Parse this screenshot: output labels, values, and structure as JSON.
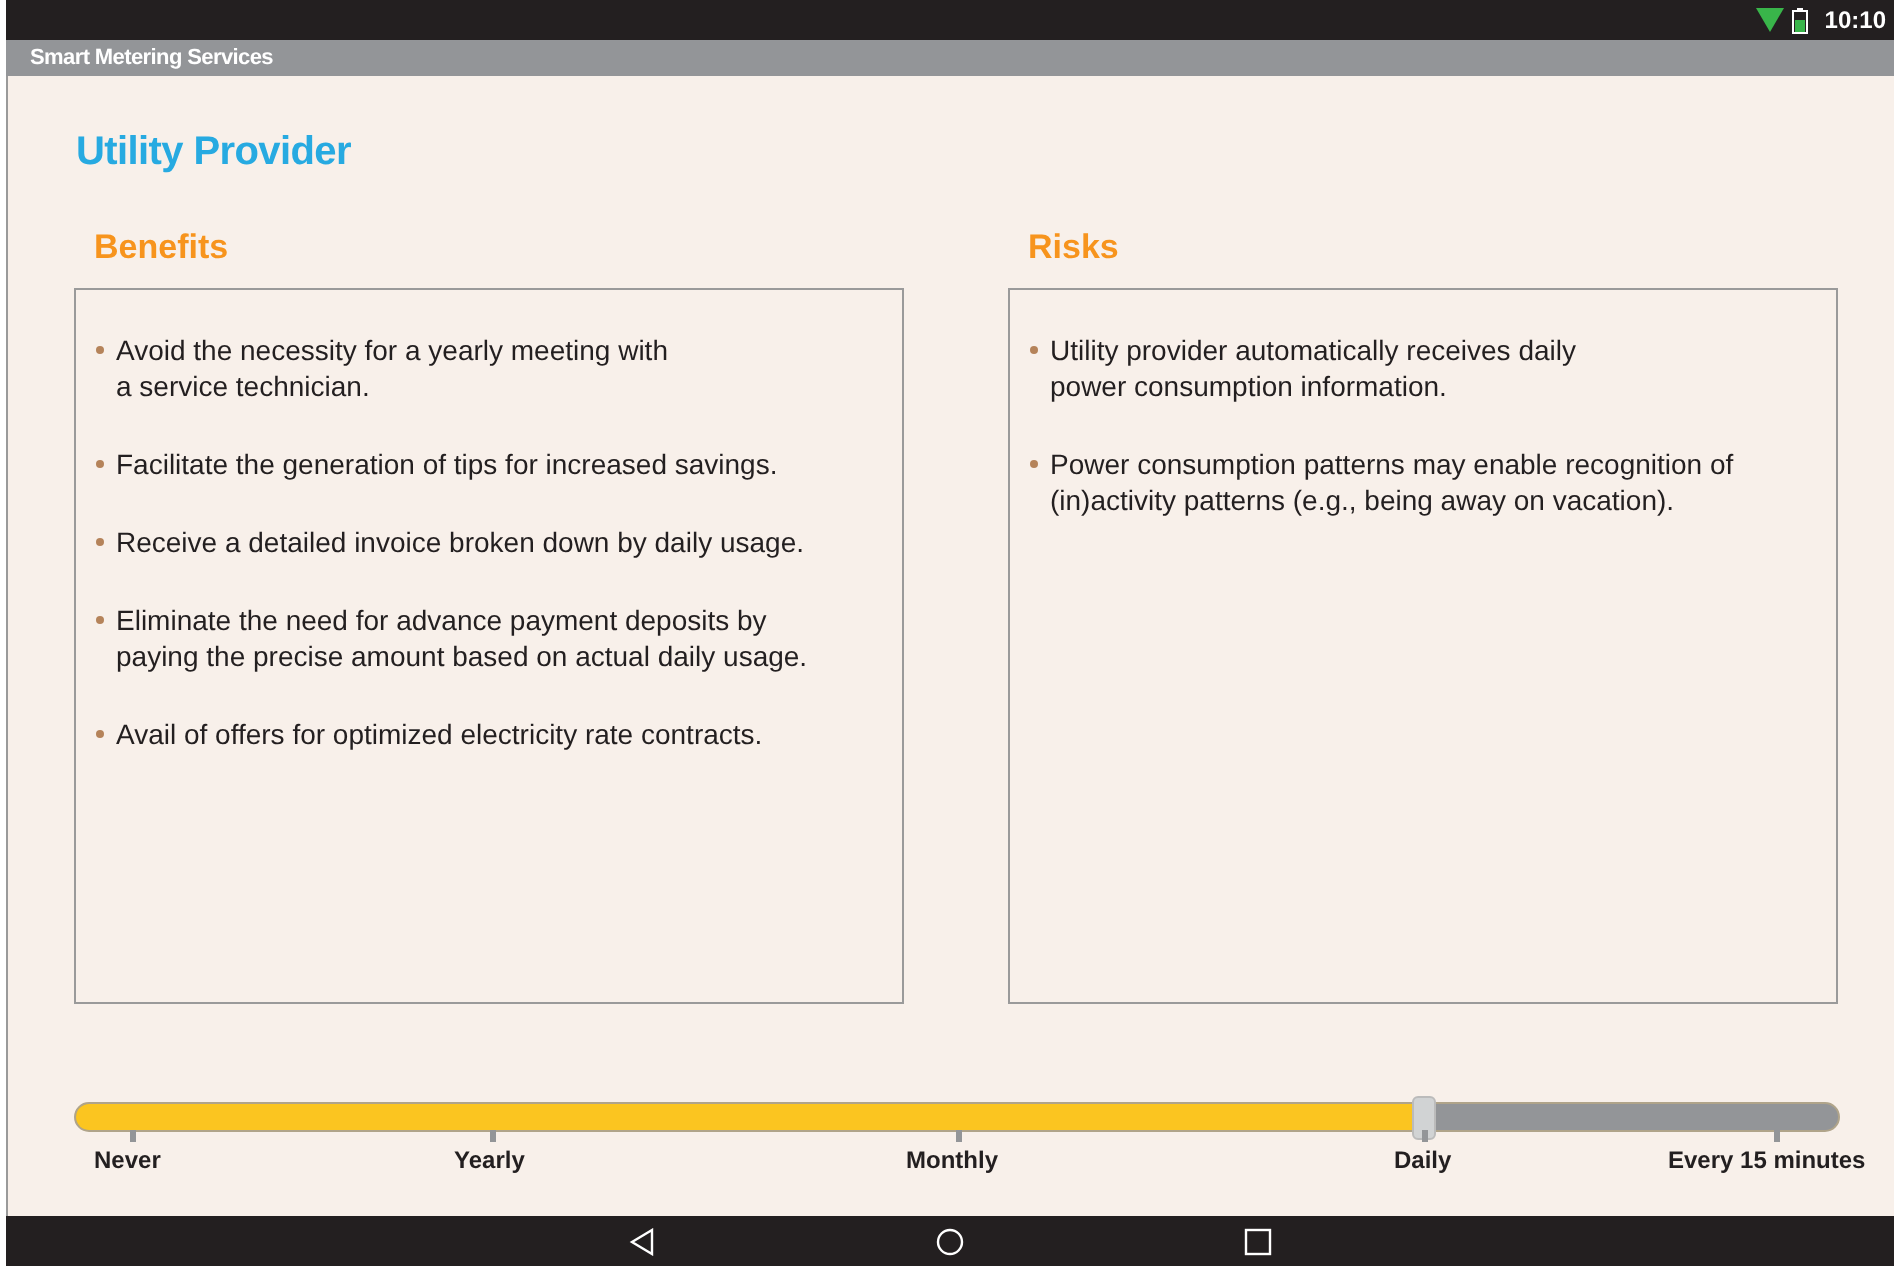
{
  "status_bar": {
    "time": "10:10"
  },
  "app_bar": {
    "title": "Smart Metering Services"
  },
  "page_title": "Utility Provider",
  "panels": [
    {
      "heading": "Benefits",
      "items": [
        "Avoid the necessity for a yearly meeting with\na service technician.",
        "Facilitate the generation of tips for increased savings.",
        "Receive a detailed invoice broken down by daily usage.",
        "Eliminate the need for advance payment deposits by\npaying the precise amount based on actual daily usage.",
        "Avail of offers for optimized electricity rate contracts."
      ]
    },
    {
      "heading": "Risks",
      "items": [
        "Utility provider automatically receives daily\npower consumption information.",
        "Power consumption patterns may enable recognition of\n(in)activity patterns (e.g., being away on vacation)."
      ]
    }
  ],
  "slider": {
    "level": 0.764,
    "stops": [
      "Never",
      "Yearly",
      "Monthly",
      "Daily",
      "Every 15 minutes"
    ]
  }
}
